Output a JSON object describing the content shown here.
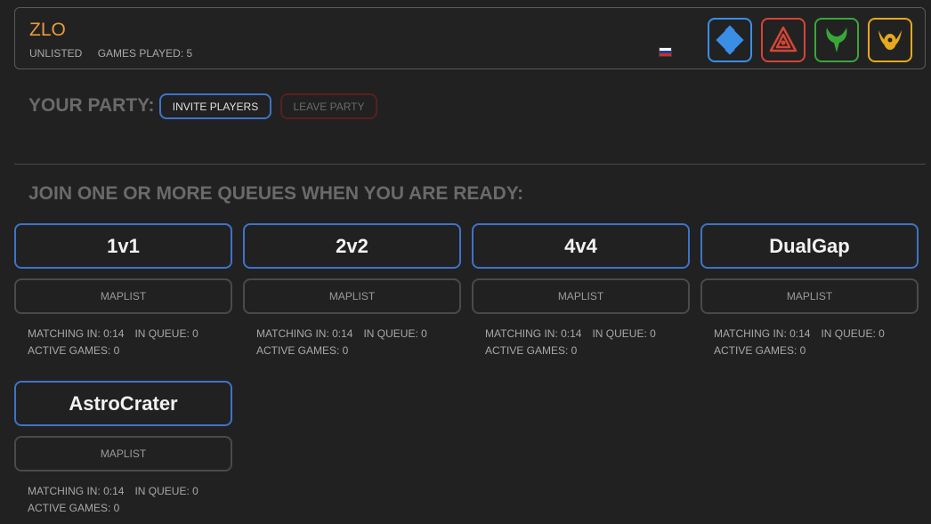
{
  "profile": {
    "name": "ZLO",
    "status": "UNLISTED",
    "games_played": "GAMES PLAYED: 5",
    "flag": {
      "colors": [
        "#ffffff",
        "#1c3fa8",
        "#d52b1e"
      ]
    },
    "races": [
      {
        "icon": "blue-diamond-grid-icon",
        "color": "#3a8ee6"
      },
      {
        "icon": "red-triangle-emblem-icon",
        "color": "#d64536"
      },
      {
        "icon": "green-claw-icon",
        "color": "#3aa63a"
      },
      {
        "icon": "gold-beetle-icon",
        "color": "#e6a91e"
      }
    ]
  },
  "party": {
    "label": "YOUR PARTY:",
    "invite_label": "INVITE PLAYERS",
    "leave_label": "LEAVE PARTY"
  },
  "queues_heading": "JOIN ONE OR MORE QUEUES WHEN YOU ARE READY:",
  "queues": [
    {
      "name": "1v1",
      "maplist": "MAPLIST",
      "matching": "MATCHING IN: 0:14",
      "in_queue": "IN QUEUE: 0",
      "active": "ACTIVE GAMES: 0"
    },
    {
      "name": "2v2",
      "maplist": "MAPLIST",
      "matching": "MATCHING IN: 0:14",
      "in_queue": "IN QUEUE: 0",
      "active": "ACTIVE GAMES: 0"
    },
    {
      "name": "4v4",
      "maplist": "MAPLIST",
      "matching": "MATCHING IN: 0:14",
      "in_queue": "IN QUEUE: 0",
      "active": "ACTIVE GAMES: 0"
    },
    {
      "name": "DualGap",
      "maplist": "MAPLIST",
      "matching": "MATCHING IN: 0:14",
      "in_queue": "IN QUEUE: 0",
      "active": "ACTIVE GAMES: 0"
    },
    {
      "name": "AstroCrater",
      "maplist": "MAPLIST",
      "matching": "MATCHING IN: 0:14",
      "in_queue": "IN QUEUE: 0",
      "active": "ACTIVE GAMES: 0"
    }
  ]
}
